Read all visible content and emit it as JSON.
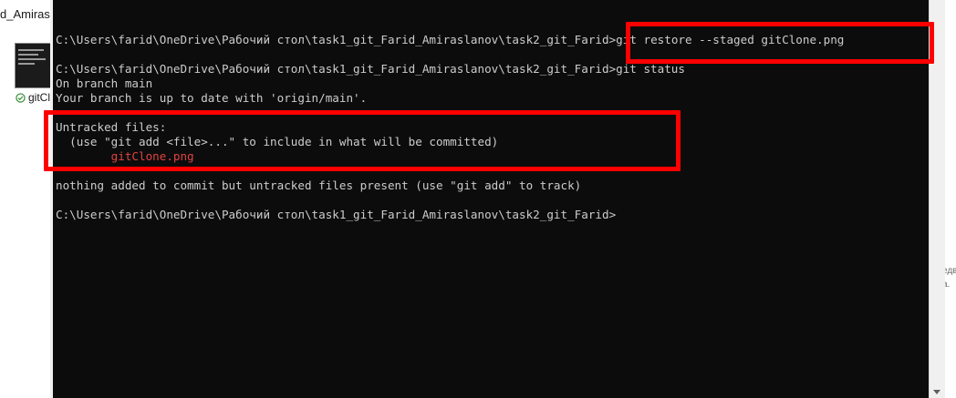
{
  "explorer": {
    "crumb": "d_Amirasla",
    "file_label": "gitCl",
    "right_fragment": [
      "едв",
      "а."
    ]
  },
  "terminal": {
    "lines": {
      "cmd_restore_prompt": "C:\\Users\\farid\\OneDrive\\Рабочий стол\\task1_git_Farid_Amiraslanov\\task2_git_Farid>",
      "cmd_restore": "git restore --staged gitClone.png",
      "cmd_status": "C:\\Users\\farid\\OneDrive\\Рабочий стол\\task1_git_Farid_Amiraslanov\\task2_git_Farid>git status",
      "on_branch": "On branch main",
      "up_to_date": "Your branch is up to date with 'origin/main'.",
      "untracked_header": "Untracked files:",
      "untracked_hint": "  (use \"git add <file>...\" to include in what will be committed)",
      "untracked_file": "        gitClone.png",
      "nothing_added": "nothing added to commit but untracked files present (use \"git add\" to track)",
      "final_prompt": "C:\\Users\\farid\\OneDrive\\Рабочий стол\\task1_git_Farid_Amiraslanov\\task2_git_Farid>"
    },
    "colors": {
      "background": "#0c0c0c",
      "text": "#cccccc",
      "untracked": "#e04343",
      "highlight": "#ff0000"
    }
  }
}
